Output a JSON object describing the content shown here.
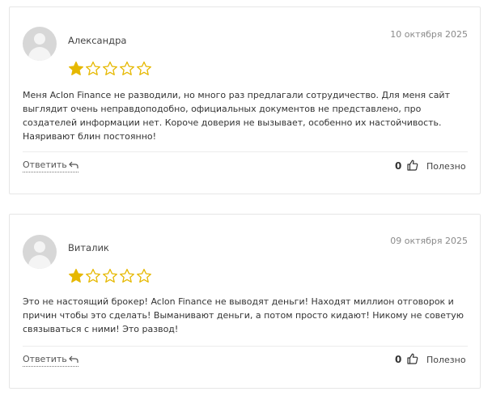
{
  "colors": {
    "star_filled": "#e6b800",
    "star_empty_outline": "#e6b800",
    "border": "#e6e6e6",
    "date": "#8a8a8a"
  },
  "icons": {
    "avatar": "user-placeholder-icon",
    "star": "star-icon",
    "reply": "reply-arrow-icon",
    "like": "thumbs-up-icon"
  },
  "reviews": [
    {
      "author": "Александра",
      "date": "10 октября 2025",
      "rating": 1,
      "max_rating": 5,
      "text": "Меня Aclon Finance не разводили, но много раз предлагали сотрудичество. Для меня сайт выглядит очень неправдоподобно, официальных документов не представлено, про создателей информации нет. Короче доверия не вызывает, особенно их настойчивость. Наяривают блин постоянно!",
      "reply_label": "Ответить",
      "likes": "0",
      "useful_label": "Полезно"
    },
    {
      "author": "Виталик",
      "date": "09 октября 2025",
      "rating": 1,
      "max_rating": 5,
      "text": "Это не настоящий брокер! Aclon Finance не выводят деньги! Находят миллион отговорок и причин чтобы это сделать! Выманивают деньги, а потом просто кидают! Никому не советую связываться с ними! Это развод!",
      "reply_label": "Ответить",
      "likes": "0",
      "useful_label": "Полезно"
    }
  ]
}
